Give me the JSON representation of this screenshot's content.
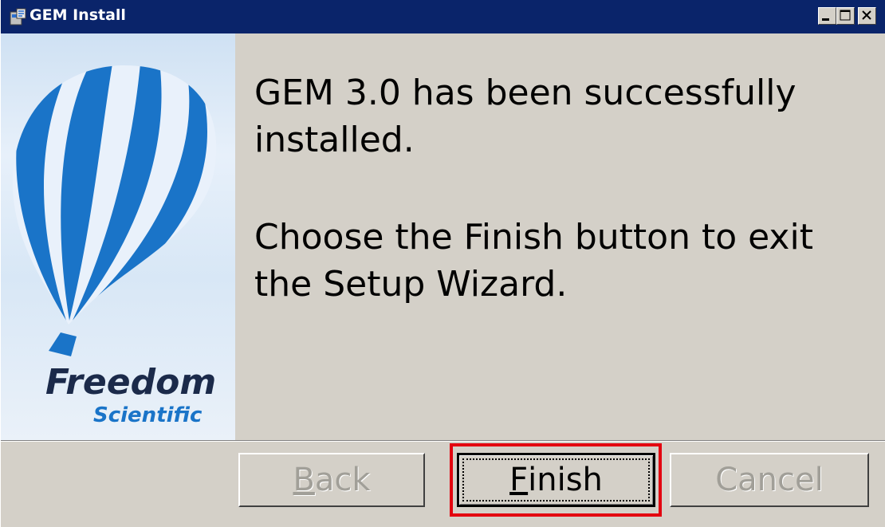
{
  "window": {
    "title": "GEM Install",
    "controls": [
      "minimize-icon",
      "maximize-icon",
      "close-icon"
    ]
  },
  "logo": {
    "brand_line1": "Freedom",
    "brand_line2": "Scientific",
    "brand_mark": "·"
  },
  "message": {
    "line1": "GEM 3.0 has been successfully installed.",
    "line2": "Choose the Finish button to exit the Setup Wizard."
  },
  "buttons": {
    "back": {
      "prefix": "",
      "accel": "B",
      "rest": "ack",
      "enabled": false
    },
    "finish": {
      "prefix": "",
      "accel": "F",
      "rest": "inish",
      "enabled": true
    },
    "cancel": {
      "label": "Cancel",
      "enabled": false
    }
  },
  "colors": {
    "titlebar": "#0a246a",
    "dialog_bg": "#d4d0c8",
    "balloon_blue": "#1a74c8",
    "highlight": "#e3000f"
  }
}
